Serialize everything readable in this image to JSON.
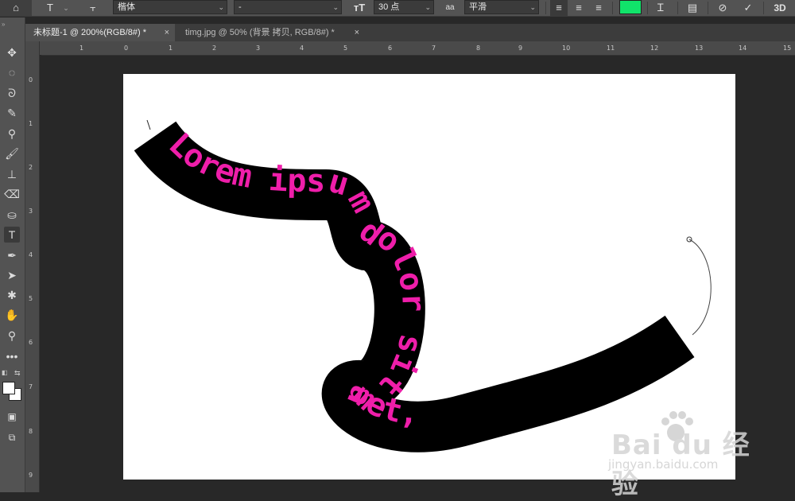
{
  "options": {
    "font_family": "楷体",
    "font_style": "-",
    "font_size": "30 点",
    "aa_icon_text": "aa",
    "antialias": "平滑",
    "text_color": "#11e36a",
    "three_d_label": "3D"
  },
  "tabs": [
    {
      "label": "未标题-1 @ 200%(RGB/8#) *",
      "close": "×"
    },
    {
      "label": "timg.jpg @ 50% (背景 拷贝, RGB/8#) *",
      "close": "×"
    }
  ],
  "ruler": {
    "h_labels": [
      "1",
      "0",
      "1",
      "2",
      "3",
      "4",
      "5",
      "6",
      "7",
      "8",
      "9",
      "10",
      "11",
      "12",
      "13",
      "14",
      "15"
    ],
    "v_labels": [
      "0",
      "1",
      "2",
      "3",
      "4",
      "5",
      "6",
      "7",
      "8",
      "9"
    ]
  },
  "canvas_text": "Lorem ipsum dolor sit amet,",
  "text_color_hex": "#ef1eaa",
  "watermark": {
    "brand": "Bai du 经验",
    "url": "jingyan.baidu.com"
  }
}
